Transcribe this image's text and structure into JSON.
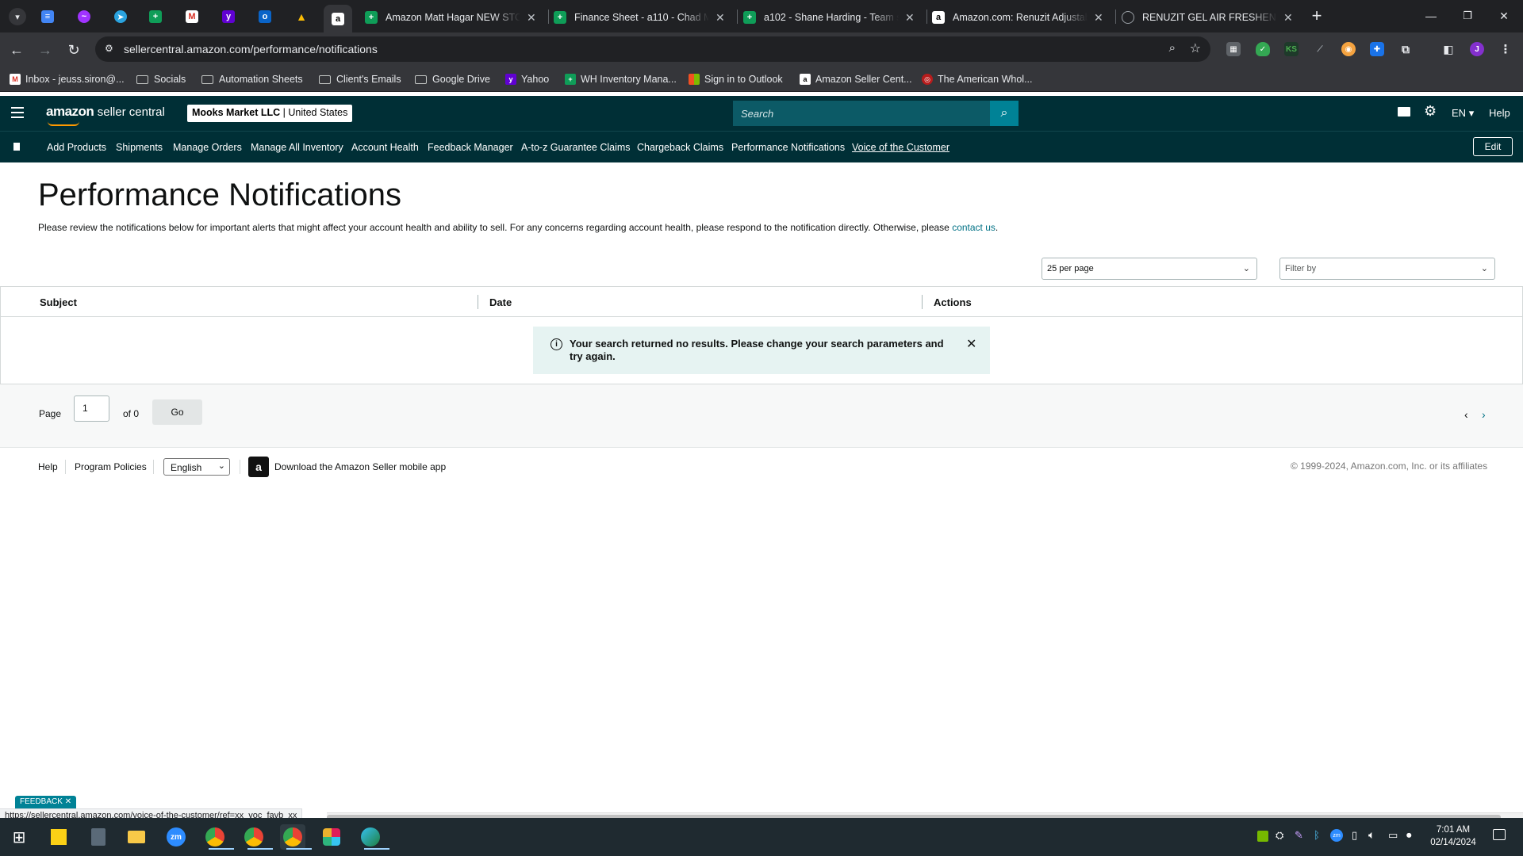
{
  "browser": {
    "tabs": [
      {
        "title": "Amazon Matt Hagar NEW STOR"
      },
      {
        "title": "Finance Sheet - a110 - Chad M"
      },
      {
        "title": "a102 - Shane Harding - Team sh"
      },
      {
        "title": "Amazon.com: Renuzit Adjustabl"
      },
      {
        "title": "RENUZIT GEL AIR FRESHENER-"
      }
    ],
    "url": "sellercentral.amazon.com/performance/notifications",
    "bookmarks": [
      "Inbox - jeuss.siron@...",
      "Socials",
      "Automation Sheets",
      "Client's Emails",
      "Google Drive",
      "Yahoo",
      "WH Inventory Mana...",
      "Sign in to Outlook",
      "Amazon Seller Cent...",
      "The American Whol..."
    ],
    "profile_initial": "J",
    "status_url": "https://sellercentral.amazon.com/voice-of-the-customer/ref=xx_voc_favb_xx"
  },
  "header": {
    "logo_main": "amazon",
    "logo_sub": "seller central",
    "store_name": "Mooks Market LLC",
    "store_country": "United States",
    "search_placeholder": "Search",
    "language": "EN",
    "help": "Help"
  },
  "nav": {
    "links": [
      "Add Products",
      "Shipments",
      "Manage Orders",
      "Manage All Inventory",
      "Account Health",
      "Feedback Manager",
      "A-to-z Guarantee Claims",
      "Chargeback Claims",
      "Performance Notifications",
      "Voice of the Customer"
    ],
    "edit": "Edit"
  },
  "page": {
    "title": "Performance Notifications",
    "intro": "Please review the notifications below for important alerts that might affect your account health and ability to sell. For any concerns regarding account health, please respond to the notification directly. Otherwise, please ",
    "intro_link": "contact us",
    "intro_end": ".",
    "per_page": "25 per page",
    "filter_placeholder": "Filter by",
    "columns": [
      "Subject",
      "Date",
      "Actions"
    ],
    "alert": "Your search returned no results. Please change your search parameters and try again.",
    "pager": {
      "label": "Page",
      "value": "1",
      "of": "of 0",
      "go": "Go"
    }
  },
  "footer": {
    "help": "Help",
    "policies": "Program Policies",
    "language": "English",
    "app": "Download the Amazon Seller mobile app",
    "copyright": "© 1999-2024, Amazon.com, Inc. or its affiliates"
  },
  "feedback_tab": "FEEDBACK",
  "taskbar": {
    "time": "7:01 AM",
    "date": "02/14/2024"
  }
}
